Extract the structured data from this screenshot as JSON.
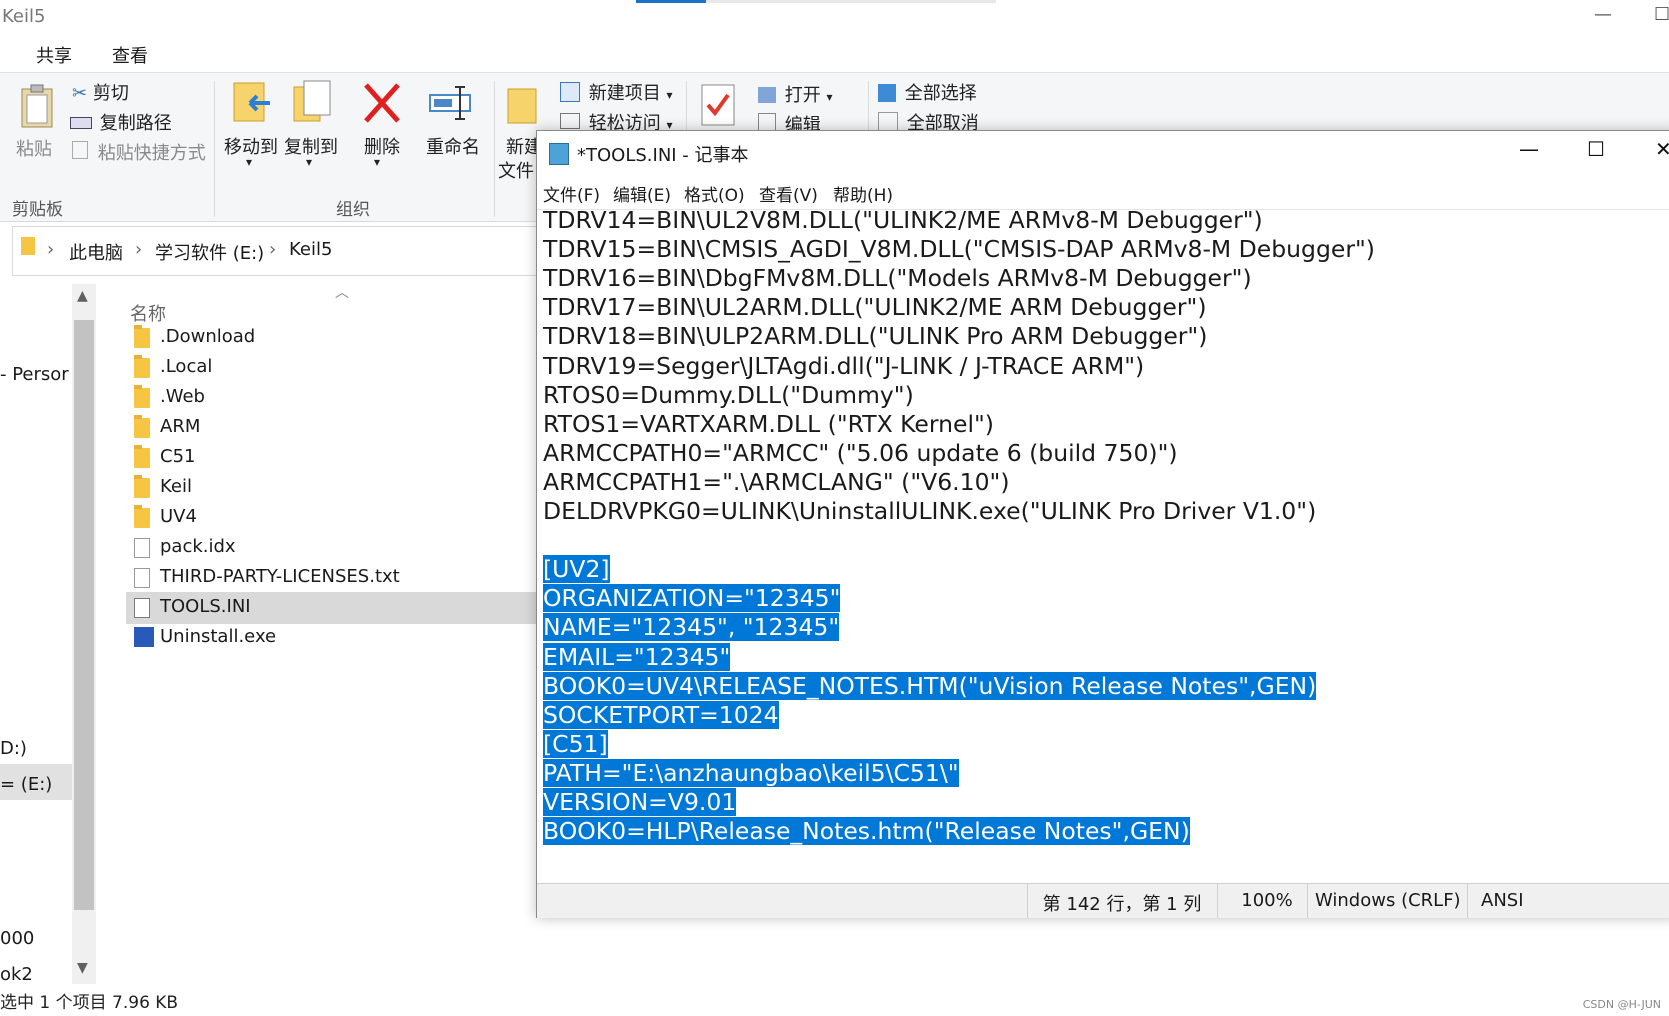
{
  "explorer": {
    "title": "Keil5",
    "controls": {
      "minimize": "—",
      "restore": "☐"
    },
    "ribbon_tabs": [
      "共享",
      "查看"
    ],
    "clipboard": {
      "paste": "粘贴",
      "cut": "剪切",
      "copy_path": "复制路径",
      "paste_shortcut": "粘贴快捷方式",
      "group": "剪贴板"
    },
    "organize": {
      "move_to": "移动到",
      "copy_to": "复制到",
      "delete": "删除",
      "rename": "重命名",
      "group": "组织"
    },
    "new": {
      "new_top": "新建",
      "new_bottom": "文件",
      "new_item": "新建项目",
      "easy_access": "轻松访问"
    },
    "open": {
      "open": "打开",
      "edit": "编辑"
    },
    "select": {
      "select_all": "全部选择",
      "select_none": "全部取消"
    },
    "address": {
      "pc": "此电脑",
      "drive": "学习软件 (E:)",
      "folder": "Keil5"
    },
    "nav": [
      "- Persor",
      "D:)",
      "= (E:)",
      "000",
      "ok2"
    ],
    "column_name": "名称",
    "files": [
      {
        "name": ".Download",
        "type": "folder"
      },
      {
        "name": ".Local",
        "type": "folder"
      },
      {
        "name": ".Web",
        "type": "folder"
      },
      {
        "name": "ARM",
        "type": "folder"
      },
      {
        "name": "C51",
        "type": "folder"
      },
      {
        "name": "Keil",
        "type": "folder"
      },
      {
        "name": "UV4",
        "type": "folder"
      },
      {
        "name": "pack.idx",
        "type": "doc"
      },
      {
        "name": "THIRD-PARTY-LICENSES.txt",
        "type": "doc"
      },
      {
        "name": "TOOLS.INI",
        "type": "ini"
      },
      {
        "name": "Uninstall.exe",
        "type": "exe"
      }
    ],
    "status": "选中 1 个项目  7.96 KB",
    "watermark": "CSDN @H-JUN"
  },
  "notepad": {
    "title": "*TOOLS.INI - 记事本",
    "controls": {
      "minimize": "—",
      "maximize": "☐",
      "close": "✕"
    },
    "menu": [
      "文件(F)",
      "编辑(E)",
      "格式(O)",
      "查看(V)",
      "帮助(H)"
    ],
    "lines": [
      "TDRV14=BIN\\UL2V8M.DLL(\"ULINK2/ME ARMv8-M Debugger\")",
      "TDRV15=BIN\\CMSIS_AGDI_V8M.DLL(\"CMSIS-DAP ARMv8-M Debugger\")",
      "TDRV16=BIN\\DbgFMv8M.DLL(\"Models ARMv8-M Debugger\")",
      "TDRV17=BIN\\UL2ARM.DLL(\"ULINK2/ME ARM Debugger\")",
      "TDRV18=BIN\\ULP2ARM.DLL(\"ULINK Pro ARM Debugger\")",
      "TDRV19=Segger\\JLTAgdi.dll(\"J-LINK / J-TRACE ARM\")",
      "RTOS0=Dummy.DLL(\"Dummy\")",
      "RTOS1=VARTXARM.DLL (\"RTX Kernel\")",
      "ARMCCPATH0=\"ARMCC\" (\"5.06 update 6 (build 750)\")",
      "ARMCCPATH1=\".\\ARMCLANG\" (\"V6.10\")",
      "DELDRVPKG0=ULINK\\UninstallULINK.exe(\"ULINK Pro Driver V1.0\")",
      "",
      "[UV2]",
      "ORGANIZATION=\"12345\"",
      "NAME=\"12345\", \"12345\"",
      "EMAIL=\"12345\"",
      "BOOK0=UV4\\RELEASE_NOTES.HTM(\"uVision Release Notes\",GEN)",
      "SOCKETPORT=1024",
      "[C51]",
      "PATH=\"E:\\anzhaungbao\\keil5\\C51\\\"",
      "VERSION=V9.01",
      "BOOK0=HLP\\Release_Notes.htm(\"Release Notes\",GEN)"
    ],
    "selected_from_line": 12,
    "status": {
      "position": "第 142 行，第 1 列",
      "zoom": "100%",
      "eol": "Windows (CRLF)",
      "encoding": "ANSI"
    }
  }
}
